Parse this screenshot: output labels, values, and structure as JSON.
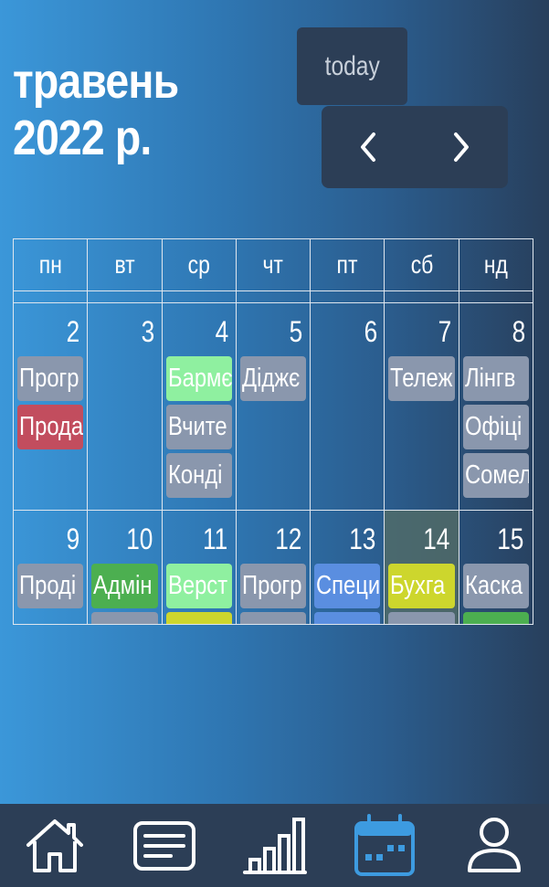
{
  "header": {
    "month": "травень",
    "year": "2022 р.",
    "today_label": "today",
    "prev_icon": "chevron-left",
    "next_icon": "chevron-right"
  },
  "weekdays": [
    "пн",
    "вт",
    "ср",
    "чт",
    "пт",
    "сб",
    "нд"
  ],
  "weeks": [
    {
      "days": [
        {
          "num": "2",
          "events": [
            {
              "title": "Прогр",
              "color": "#8a97ad"
            },
            {
              "title": "Прода",
              "color": "#c24d5e"
            }
          ]
        },
        {
          "num": "3",
          "events": []
        },
        {
          "num": "4",
          "events": [
            {
              "title": "Бармє",
              "color": "#8ff0a0"
            },
            {
              "title": "Вчите",
              "color": "#8a97ad"
            },
            {
              "title": "Конді",
              "color": "#8a97ad"
            }
          ]
        },
        {
          "num": "5",
          "events": [
            {
              "title": "Діджє",
              "color": "#8a97ad"
            }
          ]
        },
        {
          "num": "6",
          "events": []
        },
        {
          "num": "7",
          "events": [
            {
              "title": "Тележ",
              "color": "#8a97ad"
            }
          ]
        },
        {
          "num": "8",
          "events": [
            {
              "title": "Лінгв",
              "color": "#8a97ad"
            },
            {
              "title": "Офіці",
              "color": "#8a97ad"
            },
            {
              "title": "Сомел",
              "color": "#8a97ad"
            }
          ]
        }
      ]
    },
    {
      "days": [
        {
          "num": "9",
          "events": [
            {
              "title": "Проді",
              "color": "#8a97ad"
            }
          ]
        },
        {
          "num": "10",
          "events": [
            {
              "title": "Адмін",
              "color": "#4caf50"
            },
            {
              "title": "",
              "color": "#8a97ad"
            }
          ]
        },
        {
          "num": "11",
          "events": [
            {
              "title": "Верст",
              "color": "#8ff0a0"
            },
            {
              "title": "",
              "color": "#cdd62d"
            }
          ]
        },
        {
          "num": "12",
          "events": [
            {
              "title": "Прогр",
              "color": "#8a97ad"
            },
            {
              "title": "",
              "color": "#8a97ad"
            }
          ]
        },
        {
          "num": "13",
          "events": [
            {
              "title": "Специ",
              "color": "#5a8ee0"
            },
            {
              "title": "",
              "color": "#5a8ee0"
            }
          ]
        },
        {
          "num": "14",
          "today": true,
          "events": [
            {
              "title": "Бухга",
              "color": "#cdd62d"
            },
            {
              "title": "",
              "color": "#8a97ad"
            }
          ]
        },
        {
          "num": "15",
          "events": [
            {
              "title": "Каска",
              "color": "#8a97ad"
            },
            {
              "title": "",
              "color": "#4caf50"
            }
          ]
        }
      ]
    }
  ],
  "bottom_nav": {
    "items": [
      "home-icon",
      "news-icon",
      "stats-icon",
      "calendar-icon",
      "profile-icon"
    ],
    "active": "calendar-icon",
    "active_color": "#3d9be0"
  }
}
